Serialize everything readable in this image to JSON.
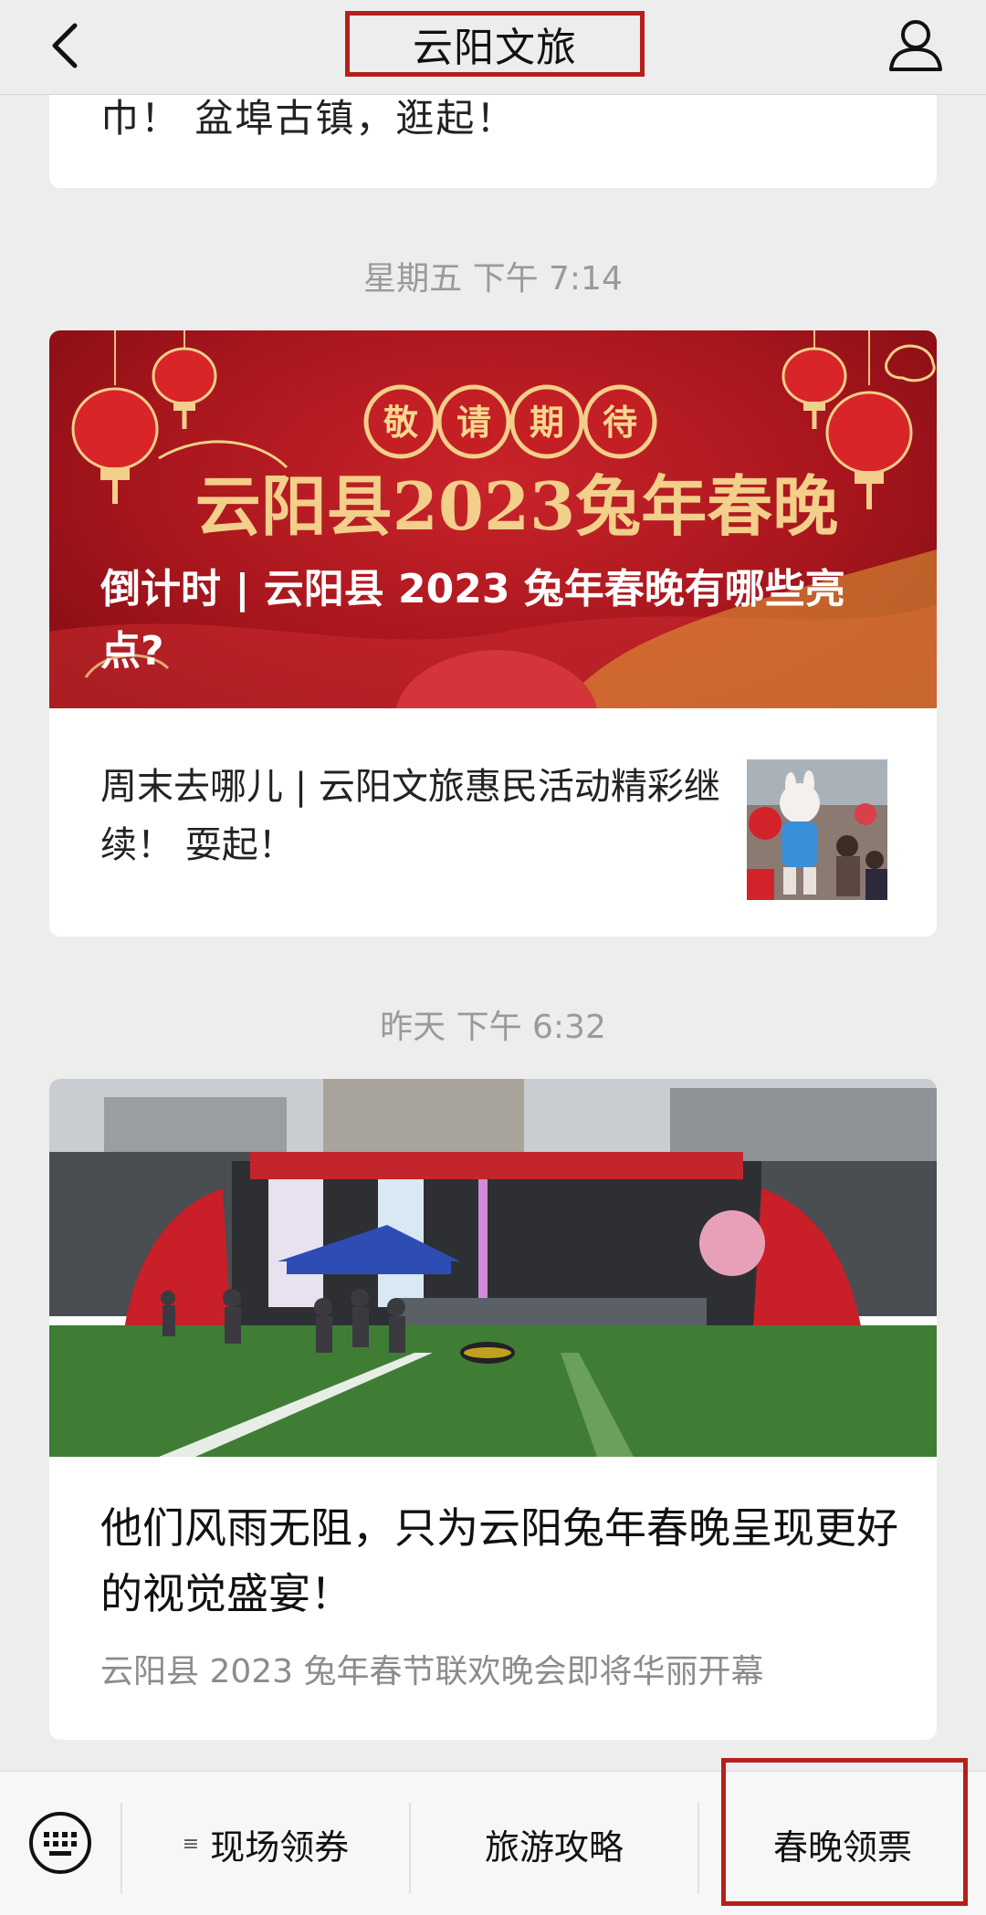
{
  "header": {
    "title": "云阳文旅",
    "back_icon": "chevron-left-icon",
    "profile_icon": "user-icon"
  },
  "feed": {
    "prev_card_text": "巾！ 盆埠古镇，逛起！",
    "timestamp1": "星期五 下午 7:14",
    "banner": {
      "headline": "倒计时 | 云阳县 2023 兔年春晚有哪些亮点?",
      "art_badge": [
        "敬",
        "请",
        "期",
        "待"
      ],
      "art_title": "云阳县2023兔年春晚"
    },
    "article2": {
      "title": "周末去哪儿 | 云阳文旅惠民活动精彩继续！ 耍起！"
    },
    "timestamp2": "昨天 下午 6:32",
    "article3": {
      "headline": "他们风雨无阻，只为云阳兔年春晚呈现更好的视觉盛宴！",
      "subtitle": "云阳县 2023 兔年春节联欢晚会即将华丽开幕"
    }
  },
  "bottom_menu": {
    "keyboard_icon": "keyboard-icon",
    "items": [
      {
        "label": "现场领券",
        "has_menu_icon": true
      },
      {
        "label": "旅游攻略",
        "has_menu_icon": false
      },
      {
        "label": "春晚领票",
        "has_menu_icon": false
      }
    ]
  },
  "colors": {
    "highlight_box": "#b5201a",
    "banner_red": "#b01a20",
    "gold": "#f2cf8a"
  }
}
